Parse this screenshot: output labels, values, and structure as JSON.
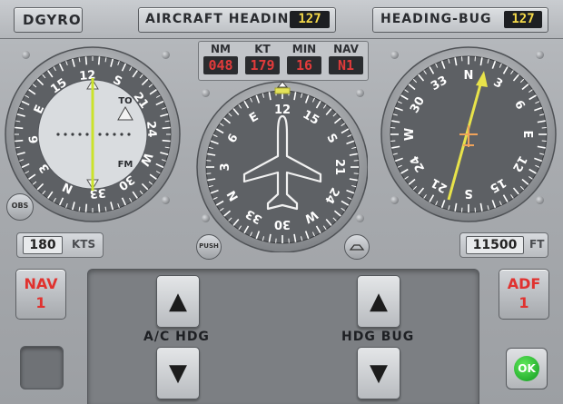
{
  "top": {
    "dgyro_label": "DGYRO",
    "aircraft_heading_label": "AIRCRAFT HEADING",
    "aircraft_heading_value": "127",
    "heading_bug_label": "HEADING-BUG",
    "heading_bug_value": "127"
  },
  "readout": {
    "nm_label": "NM",
    "nm_value": "048",
    "kt_label": "KT",
    "kt_value": "179",
    "min_label": "MIN",
    "min_value": "16",
    "nav_label": "NAV",
    "nav_value": "N1"
  },
  "left_gauge": {
    "to_label": "TO",
    "fm_label": "FM",
    "obs_label": "OBS",
    "ticks": [
      "12",
      "S",
      "21",
      "24",
      "W",
      "30",
      "33",
      "N",
      "3",
      "6",
      "E",
      "15"
    ]
  },
  "center_gauge": {
    "ticks": [
      "12",
      "15",
      "S",
      "21",
      "24",
      "W",
      "30",
      "33",
      "N",
      "3",
      "6",
      "E"
    ],
    "push_label": "PUSH"
  },
  "right_gauge": {
    "ticks": [
      "N",
      "3",
      "6",
      "E",
      "12",
      "15",
      "S",
      "21",
      "24",
      "W",
      "30",
      "33"
    ]
  },
  "airspeed": {
    "value": "180",
    "unit": "KTS"
  },
  "altitude": {
    "value": "11500",
    "unit": "FT"
  },
  "nav_button": {
    "line1": "NAV",
    "line2": "1"
  },
  "adf_button": {
    "line1": "ADF",
    "line2": "1"
  },
  "controls": {
    "ac_hdg_label": "A/C HDG",
    "hdg_bug_label": "HDG BUG",
    "up_glyph": "▲",
    "down_glyph": "▼",
    "ok_label": "OK"
  }
}
